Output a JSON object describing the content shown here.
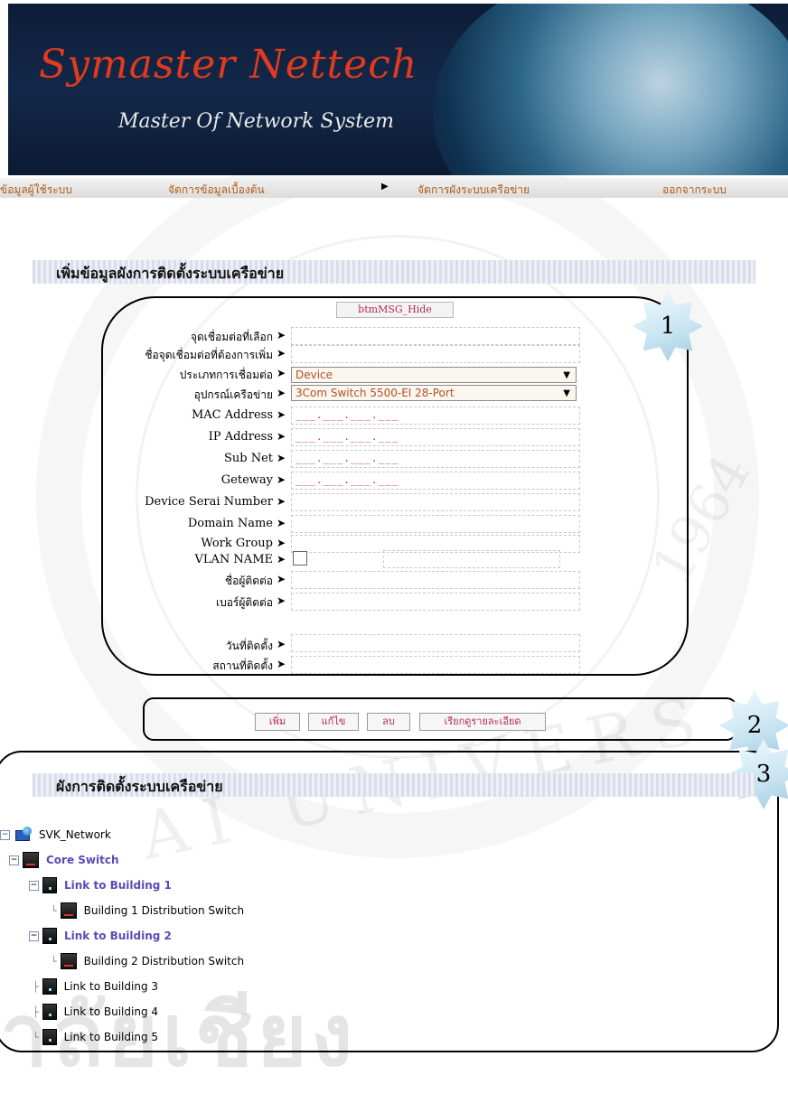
{
  "header": {
    "brand": "Symaster Nettech",
    "tagline": "Master Of Network System"
  },
  "nav": {
    "items": [
      {
        "label": "ข้อมูลผู้ใช้ระบบ"
      },
      {
        "label": "จัดการข้อมูลเบื้องต้น"
      },
      {
        "label": "จัดการผังระบบเครือข่าย"
      },
      {
        "label": "ออกจากระบบ"
      }
    ]
  },
  "form_section": {
    "title": "เพิ่มข้อมูลผังการติดตั้งระบบเครือข่าย",
    "msg_button": "btmMSG_Hide",
    "fields": {
      "selected_point": "จุดเชื่อมต่อที่เลือก",
      "new_point_name": "ชื่อจุดเชื่อมต่อที่ต้องการเพิ่ม",
      "connection_type": "ประเภทการเชื่อมต่อ",
      "network_device": "อุปกรณ์เครือข่าย",
      "mac": "MAC Address",
      "ip": "IP Address",
      "subnet": "Sub Net",
      "gateway": "Geteway",
      "serial": "Device Serai Number",
      "domain": "Domain Name",
      "workgroup": "Work Group",
      "vlan": "VLAN NAME",
      "contact_name": "ชื่อผู้ติดต่อ",
      "contact_phone": "เบอร์ผู้ติดต่อ",
      "install_date": "วันที่ติดตั้ง",
      "install_place": "สถานที่ติดตั้ง"
    },
    "values": {
      "connection_type": "Device",
      "network_device": "3Com Switch 5500-EI 28-Port",
      "ip_mask": "___.___.___.___"
    }
  },
  "actions": {
    "add": "เพิ่ม",
    "edit": "แก้ไข",
    "delete": "ลบ",
    "details": "เรียกดูรายละเอียด"
  },
  "tree_section": {
    "title": "ผังการติดตั้งระบบเครือข่าย",
    "nodes": [
      {
        "label": "SVK_Network"
      },
      {
        "label": "Core Switch"
      },
      {
        "label": "Link to Building 1"
      },
      {
        "label": "Building 1 Distribution Switch"
      },
      {
        "label": "Link to Building 2"
      },
      {
        "label": "Building 2 Distribution Switch"
      },
      {
        "label": "Link to Building 3"
      },
      {
        "label": "Link to Building 4"
      },
      {
        "label": "Link to Building 5"
      }
    ]
  },
  "callouts": [
    "1",
    "2",
    "3"
  ],
  "watermark": {
    "university": "AI UNIVERS",
    "thai": "าลัยเชียง",
    "year": "1964"
  },
  "colors": {
    "accent": "#b52c4c",
    "nav_text": "#b15a14",
    "tree_link": "#5a4bb5",
    "brand": "#e23a1f"
  }
}
